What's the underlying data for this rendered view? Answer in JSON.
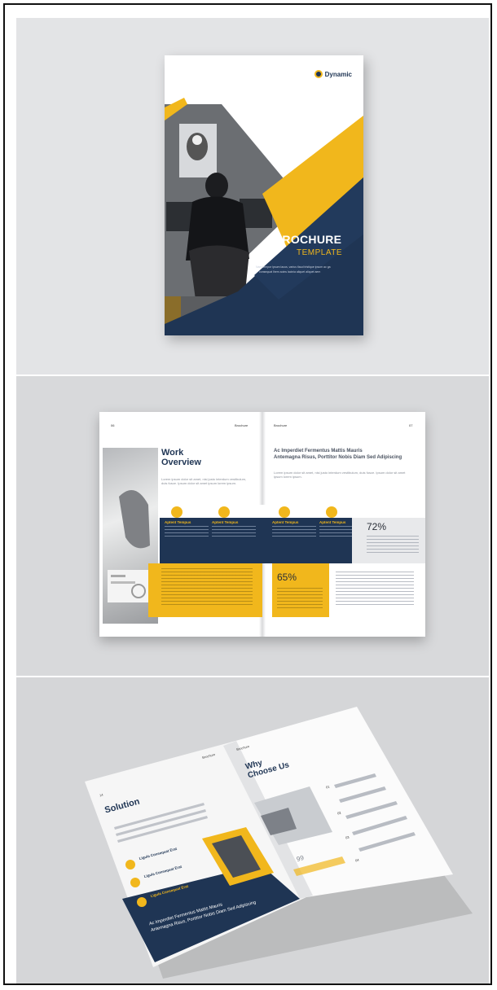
{
  "cover": {
    "brand": "Dynamic",
    "title": "BROCHURE",
    "subtitle": "TEMPLATE",
    "tagline_1": "Nam tempor ipsum lacus, varius tlaud tristique ipsum ac ga",
    "tagline_2": "consequat lhem aoins lacinia aliquet aliquet aem"
  },
  "spread1": {
    "page_left_num": "06",
    "page_left_label": "Brochure",
    "page_right_label": "Brochure",
    "page_right_num": "07",
    "heading_line1": "Work",
    "heading_line2": "Overview",
    "intro_heading_1": "Ac Imperdiet Fermentus Mattis Mauris",
    "intro_heading_2": "Antemagna Risus, Porttitor Nobis Diam Sed Adipiscing",
    "features": [
      "Aptent Tempus",
      "Aptent Tempus",
      "Aptent Tempus",
      "Aptent Tempus"
    ],
    "stat_a": "72%",
    "stat_b": "65%",
    "body_lorem": "Lorem ipsum dolor sit amet, nisi justo interdum vestibulum, duis fusce. Ipsum dolor sit amet ipsum lorem ipsum."
  },
  "spread2": {
    "page_left_num": "14",
    "page_left_label": "Brochure",
    "page_right_label": "Brochure",
    "solution_title": "Solution",
    "why_line1": "Why",
    "why_line2": "Choose Us",
    "items": [
      "Ligula Consequat Erat",
      "Ligula Consequat Erat",
      "Ligula Consequat Erat"
    ],
    "footer_1": "Ac Imperdiet Fermentus Mattis Mauris",
    "footer_2": "Antemagna Risus, Porttitor Nobis Diam Sed Adipiscing",
    "num_labels": [
      "01",
      "02",
      "03",
      "04"
    ],
    "quote_mark": "99"
  }
}
